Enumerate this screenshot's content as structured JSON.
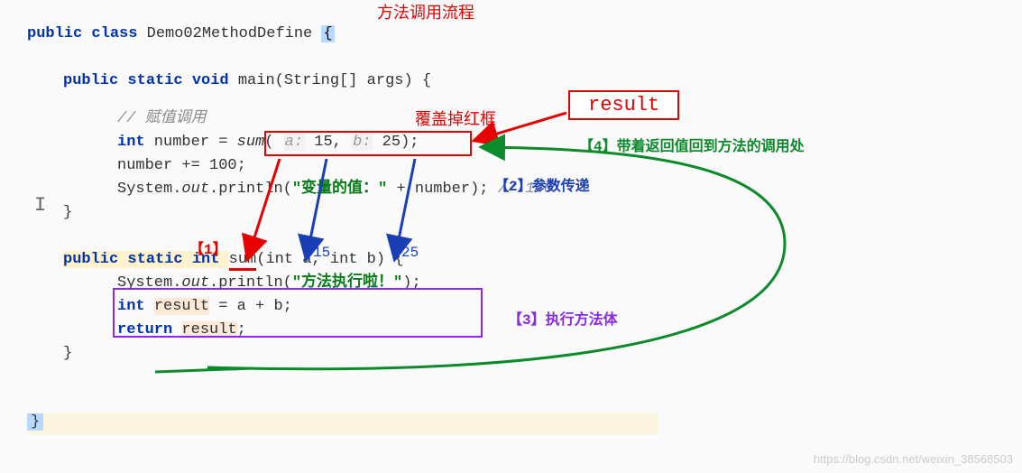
{
  "title": "方法调用流程",
  "code": {
    "declClass": "public class ",
    "className": "Demo02MethodDefine",
    "mainDecl1": "public static void ",
    "mainName": "main",
    "mainDecl2": "(String[] args) {",
    "comment1": "// 赋值调用",
    "intKw": "int",
    "numberVar": " number = ",
    "sumCall": "sum",
    "paramA": "a:",
    "valA": " 15",
    "paramB": "b:",
    "valB": " 25",
    "numberInc": "number += ",
    "hundred": "100",
    "semi": ";",
    "sysout": "System.",
    "out": "out",
    "println": ".println(",
    "str1": "\"变量的值：\"",
    "plusNumber": " + number); ",
    "comment2": "// 140",
    "sumDecl1": "public static int ",
    "sumName": "sum",
    "sumDecl2": "(int a, int b) {",
    "str2": "\"方法执行啦！\"",
    "closePrint": ");",
    "resultVar": "result",
    "assignAB": " = a + b;",
    "returnKw": "return ",
    "resultRet": "result;"
  },
  "annotations": {
    "coverRed": "覆盖掉红框",
    "resultLabel": "result",
    "step1": "【1】",
    "step2": "【2】参数传递",
    "step3": "【3】执行方法体",
    "step4": "【4】带着返回值回到方法的调用处",
    "num15": "15",
    "num25": "25"
  },
  "watermark": "https://blog.csdn.net/weixin_38568503"
}
